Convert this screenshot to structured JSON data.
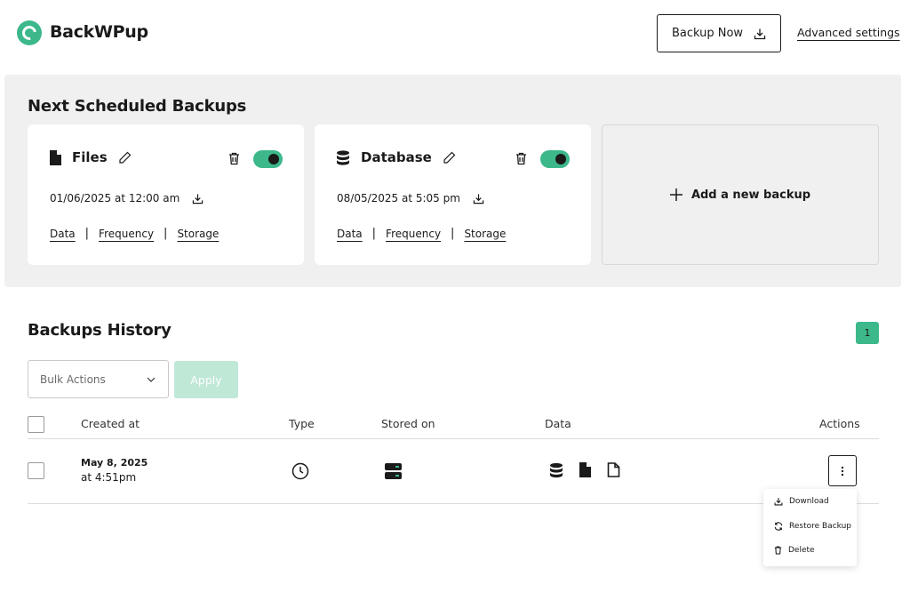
{
  "header": {
    "brand": "BackWPup",
    "backup_now_label": "Backup Now",
    "advanced_settings_label": "Advanced settings"
  },
  "scheduled": {
    "title": "Next Scheduled Backups",
    "cards": [
      {
        "title": "Files",
        "icon": "file-icon",
        "toggle_on": true,
        "date": "01/06/2025 at 12:00 am",
        "links": [
          "Data",
          "Frequency",
          "Storage"
        ]
      },
      {
        "title": "Database",
        "icon": "database-icon",
        "toggle_on": true,
        "date": "08/05/2025 at 5:05 pm",
        "links": [
          "Data",
          "Frequency",
          "Storage"
        ]
      }
    ],
    "add_new_label": "Add a new backup"
  },
  "history": {
    "title": "Backups History",
    "page_number": "1",
    "bulk_actions": {
      "selected": "Bulk Actions"
    },
    "apply_label": "Apply",
    "columns": [
      "Created at",
      "Type",
      "Stored on",
      "Data",
      "Actions"
    ],
    "rows": [
      {
        "date": "May 8, 2025",
        "time": "at 4:51pm",
        "type_icon": "clock-icon",
        "stored_icon": "server-icon",
        "data_icons": [
          "database-icon",
          "file-icon",
          "file-outline-icon"
        ]
      }
    ],
    "row_menu": [
      "Download",
      "Restore Backup",
      "Delete"
    ]
  },
  "colors": {
    "accent": "#3cb88a",
    "apply_disabled": "#bfe8d7",
    "panel_bg": "#f0f0f0"
  }
}
